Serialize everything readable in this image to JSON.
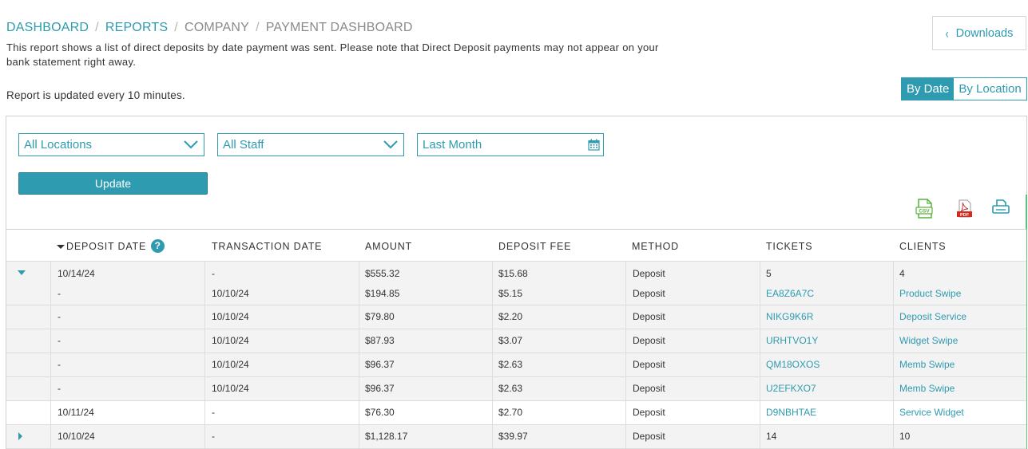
{
  "breadcrumb": {
    "items": [
      "DASHBOARD",
      "REPORTS",
      "COMPANY",
      "PAYMENT DASHBOARD"
    ],
    "separator": "/"
  },
  "description": "This report shows a list of direct deposits by date payment was sent. Please note that Direct Deposit payments may not appear on your bank statement right away.",
  "update_note": "Report is updated every 10 minutes.",
  "downloads_label": "Downloads",
  "view_toggle": {
    "by_date": "By Date",
    "by_location": "By Location",
    "active": "By Date"
  },
  "filters": {
    "location": "All Locations",
    "staff": "All Staff",
    "date_range": "Last Month"
  },
  "update_label": "Update",
  "export_icons": [
    "csv-icon",
    "pdf-icon",
    "print-icon"
  ],
  "table": {
    "headers": [
      "DEPOSIT DATE",
      "TRANSACTION DATE",
      "AMOUNT",
      "DEPOSIT FEE",
      "METHOD",
      "TICKETS",
      "CLIENTS"
    ],
    "help_symbol": "?",
    "groups": [
      {
        "expanded": true,
        "summary": {
          "deposit_date": "10/14/24",
          "transaction_date": "-",
          "amount": "$555.32",
          "fee": "$15.68",
          "method": "Deposit",
          "tickets": "5",
          "clients": "4"
        },
        "details": [
          {
            "deposit_date": "-",
            "transaction_date": "10/10/24",
            "amount": "$194.85",
            "fee": "$5.15",
            "method": "Deposit",
            "tickets": "EA8Z6A7C",
            "clients": "Product Swipe"
          },
          {
            "deposit_date": "-",
            "transaction_date": "10/10/24",
            "amount": "$79.80",
            "fee": "$2.20",
            "method": "Deposit",
            "tickets": "NIKG9K6R",
            "clients": "Deposit Service"
          },
          {
            "deposit_date": "-",
            "transaction_date": "10/10/24",
            "amount": "$87.93",
            "fee": "$3.07",
            "method": "Deposit",
            "tickets": "URHTVO1Y",
            "clients": "Widget Swipe"
          },
          {
            "deposit_date": "-",
            "transaction_date": "10/10/24",
            "amount": "$96.37",
            "fee": "$2.63",
            "method": "Deposit",
            "tickets": "QM18OXOS",
            "clients": "Memb Swipe"
          },
          {
            "deposit_date": "-",
            "transaction_date": "10/10/24",
            "amount": "$96.37",
            "fee": "$2.63",
            "method": "Deposit",
            "tickets": "U2EFKXO7",
            "clients": "Memb Swipe"
          }
        ]
      },
      {
        "expanded": false,
        "summary": {
          "deposit_date": "10/11/24",
          "transaction_date": "-",
          "amount": "$76.30",
          "fee": "$2.70",
          "method": "Deposit",
          "tickets": "D9NBHTAE",
          "clients": "Service Widget"
        }
      },
      {
        "expanded": false,
        "summary": {
          "deposit_date": "10/10/24",
          "transaction_date": "-",
          "amount": "$1,128.17",
          "fee": "$39.97",
          "method": "Deposit",
          "tickets": "14",
          "clients": "10"
        }
      }
    ]
  },
  "colors": {
    "accent": "#2e9bb0",
    "row_shade": "#f3f3f3"
  }
}
